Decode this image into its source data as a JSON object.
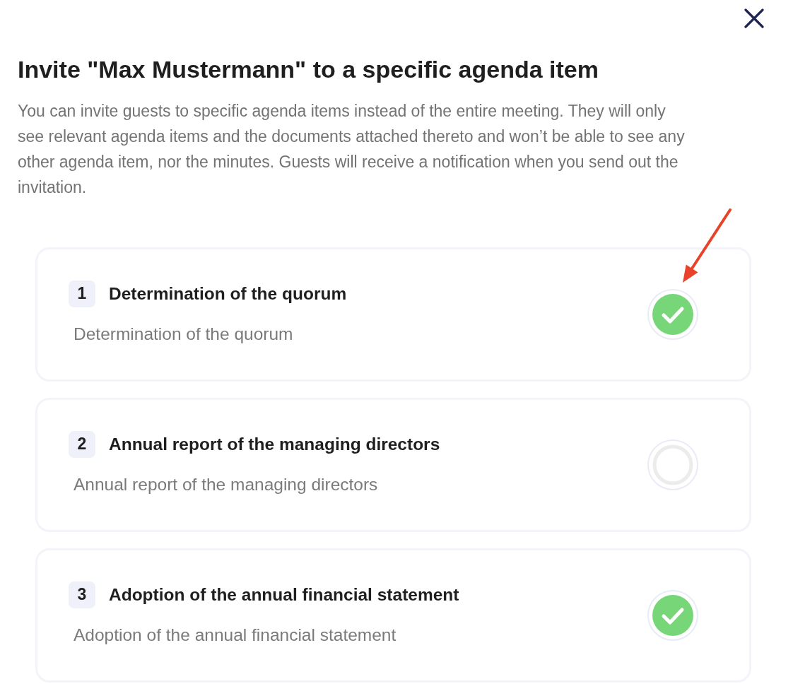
{
  "dialog": {
    "title": "Invite \"Max Mustermann\" to a specific agenda item",
    "description": "You can invite guests to specific agenda items instead of the entire meeting. They will only see relevant agenda items and the documents attached thereto and won’t be able to see any other agenda item, nor the minutes. Guests will receive a notification when you send out the invitation."
  },
  "agenda_items": [
    {
      "number": "1",
      "title": "Determination of the quorum",
      "description": "Determination of the quorum",
      "selected": true
    },
    {
      "number": "2",
      "title": "Annual report of the managing directors",
      "description": "Annual report of the managing directors",
      "selected": false
    },
    {
      "number": "3",
      "title": "Adoption of the annual financial statement",
      "description": "Adoption of the annual financial statement",
      "selected": true
    }
  ]
}
